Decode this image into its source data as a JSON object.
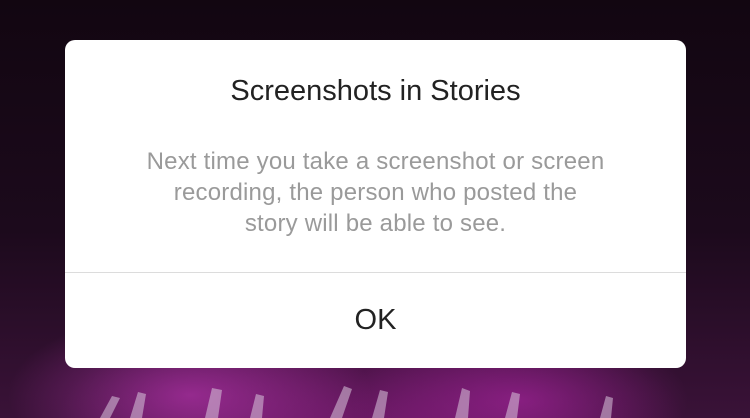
{
  "dialog": {
    "title": "Screenshots in Stories",
    "message": "Next time you take a screenshot or screen recording, the person who posted the story will be able to see.",
    "ok_label": "OK"
  },
  "colors": {
    "backdrop_dark": "#120611",
    "backdrop_glow": "#c03cba",
    "dialog_background": "#ffffff",
    "title_text": "#222222",
    "message_text": "#9a9a9a",
    "divider": "#dcdcdc"
  }
}
